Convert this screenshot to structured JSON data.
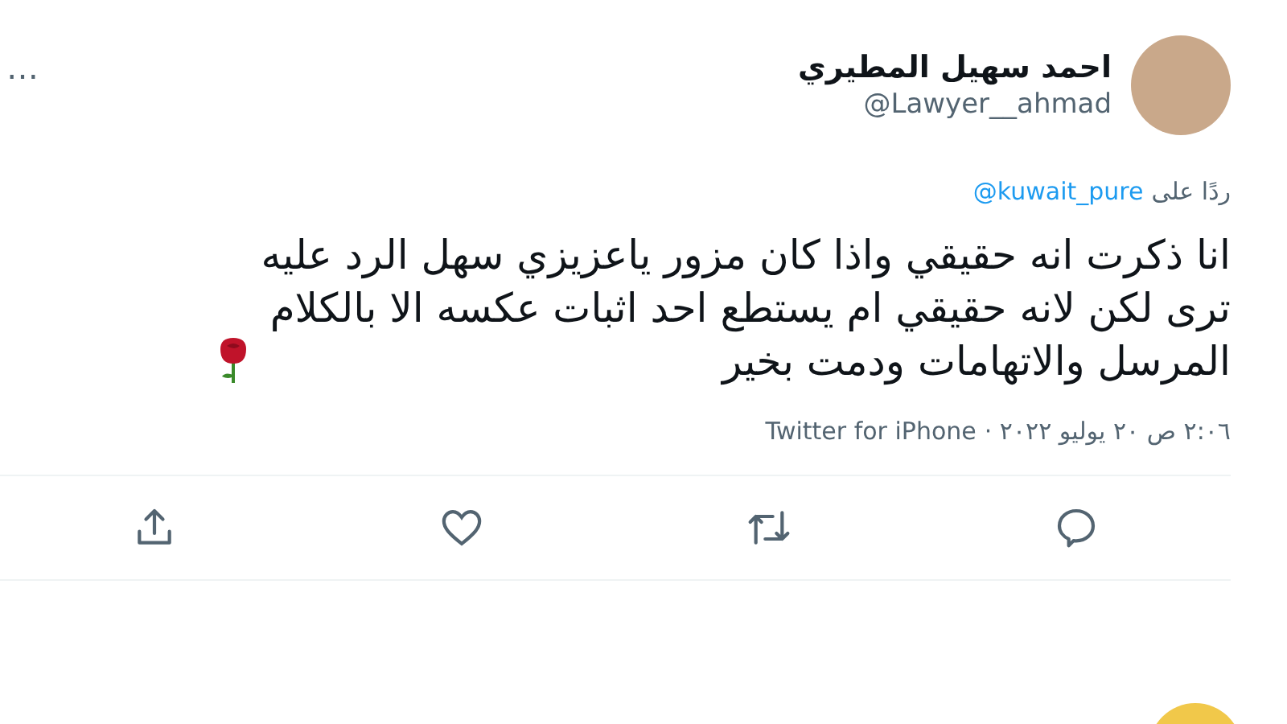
{
  "author": {
    "name": "احمد سهيل المطيري",
    "handle": "@Lawyer__ahmad"
  },
  "more": "…",
  "reply_to": {
    "prefix": "ردًا على",
    "handle": "@kuwait_pure"
  },
  "body": "انا ذكرت انه حقيقي واذا كان مزور ياعزيزي سهل الرد عليه\nترى لكن لانه حقيقي ام يستطع احد اثبات عكسه الا بالكلام\nالمرسل والاتهامات ودمت بخير",
  "meta": {
    "time": "٢:٠٦ ص ٢٠ يوليو ٢٠٢٢ ·",
    "source": "Twitter for iPhone"
  }
}
